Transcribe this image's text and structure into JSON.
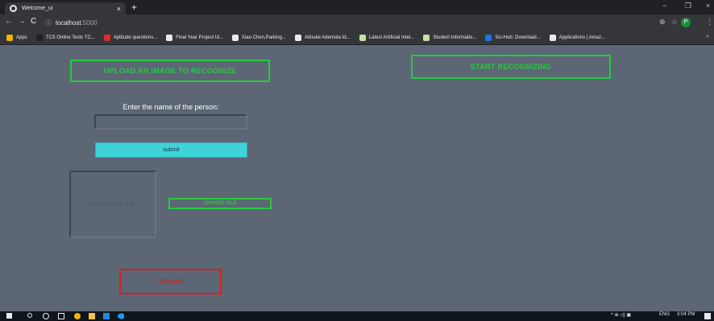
{
  "browser": {
    "tab_title": "Welcome_ui",
    "tab_close": "×",
    "new_tab": "+",
    "window_controls": {
      "minimize": "−",
      "maximize": "❐",
      "close": "×"
    },
    "nav": {
      "back": "←",
      "forward": "→",
      "reload": "C"
    },
    "url": {
      "info_icon": "ⓘ",
      "host": "localhost",
      "port": ":5000"
    },
    "toolbar_icons": {
      "zoom": "⊕",
      "star": "☆",
      "menu": "⋮"
    },
    "profile_initial": "P",
    "bookmarks": [
      {
        "label": "Apps",
        "icon_color": "#f4b400"
      },
      {
        "label": "TCS Online Tests TC...",
        "icon_color": "#202124"
      },
      {
        "label": "Aptitude questions...",
        "icon_color": "#d93025"
      },
      {
        "label": "Final Year Project Id...",
        "icon_color": "#e8eaed"
      },
      {
        "label": "Xiao Chen,Parking...",
        "icon_color": "#e8eaed"
      },
      {
        "label": "Atinuke Ademola Id...",
        "icon_color": "#e8eaed"
      },
      {
        "label": "Latest Artificial Intel...",
        "icon_color": "#c5e1a5"
      },
      {
        "label": "Student Informatio...",
        "icon_color": "#c5e1a5"
      },
      {
        "label": "Sci-Hub: Download...",
        "icon_color": "#1a73e8"
      },
      {
        "label": "Applications | Amaz...",
        "icon_color": "#e8eaed"
      }
    ],
    "bookmarks_more": "»"
  },
  "page": {
    "upload_recognize_label": "UPLOAD AN IMAGE TO RECOGNIZE",
    "start_recognizing_label": "START RECOGNIZING",
    "name_prompt": "Enter the name of the person:",
    "name_value": "",
    "submit_label": "submit",
    "file_placeholder": "choose jpg or png file",
    "choose_file_label": "CHOOSE FILE",
    "upload_label": "UPLOAD"
  },
  "taskbar": {
    "tray_icons": "^ ⊕ ◁) ▣",
    "language": "ENG",
    "time": "3:04 PM"
  },
  "colors": {
    "page_bg": "#5c6674",
    "accent_green": "#27c93f",
    "accent_cyan": "#3fd3d9",
    "accent_red": "#e21b1b"
  }
}
